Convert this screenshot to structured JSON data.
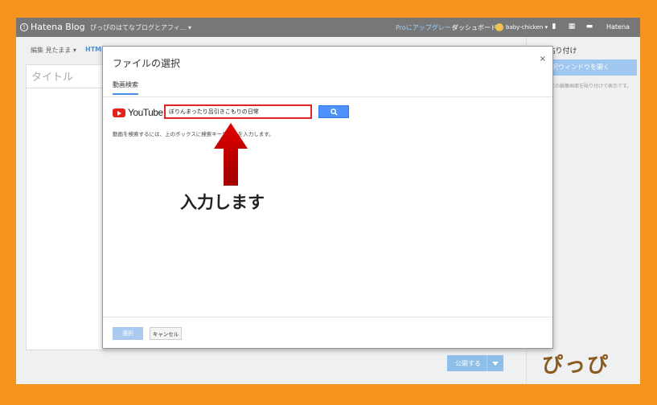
{
  "topbar": {
    "logo_text": "Hatena Blog",
    "blog_name": "ぴっぴのはてなブログとアフィ... ▾",
    "pro_link": "Proにアップグレード",
    "dashboard": "ダッシュボード",
    "user_name": "baby-chicken ▾",
    "hatena": "Hatena"
  },
  "editor": {
    "settings_label": "編集 見たまま ▾",
    "html_tab": "HTML",
    "title_placeholder": "タイトル",
    "sidebar_heading": "e貼り付け",
    "sidebar_button": "選択ウィンドウを開く",
    "sidebar_note": "本文の編集画面を貼り付けで表示です。",
    "publish_label": "公開する"
  },
  "modal": {
    "title": "ファイルの選択",
    "close": "×",
    "tab_label": "動画検索",
    "youtube_word": "YouTube",
    "search_value": "ぼりんまったり呂引きこもりの日常",
    "hint": "動画を検索するには、上のボックスに検索キーワードを入力します。",
    "select_button": "選択",
    "cancel_button": "キャンセル"
  },
  "annotation": {
    "callout": "入力します",
    "arrow_color": "#c00000"
  },
  "watermark": "ぴっぴ",
  "colors": {
    "border": "#f7941d",
    "topbar": "#777777",
    "accent": "#4d90fe",
    "highlight": "#e02424"
  }
}
